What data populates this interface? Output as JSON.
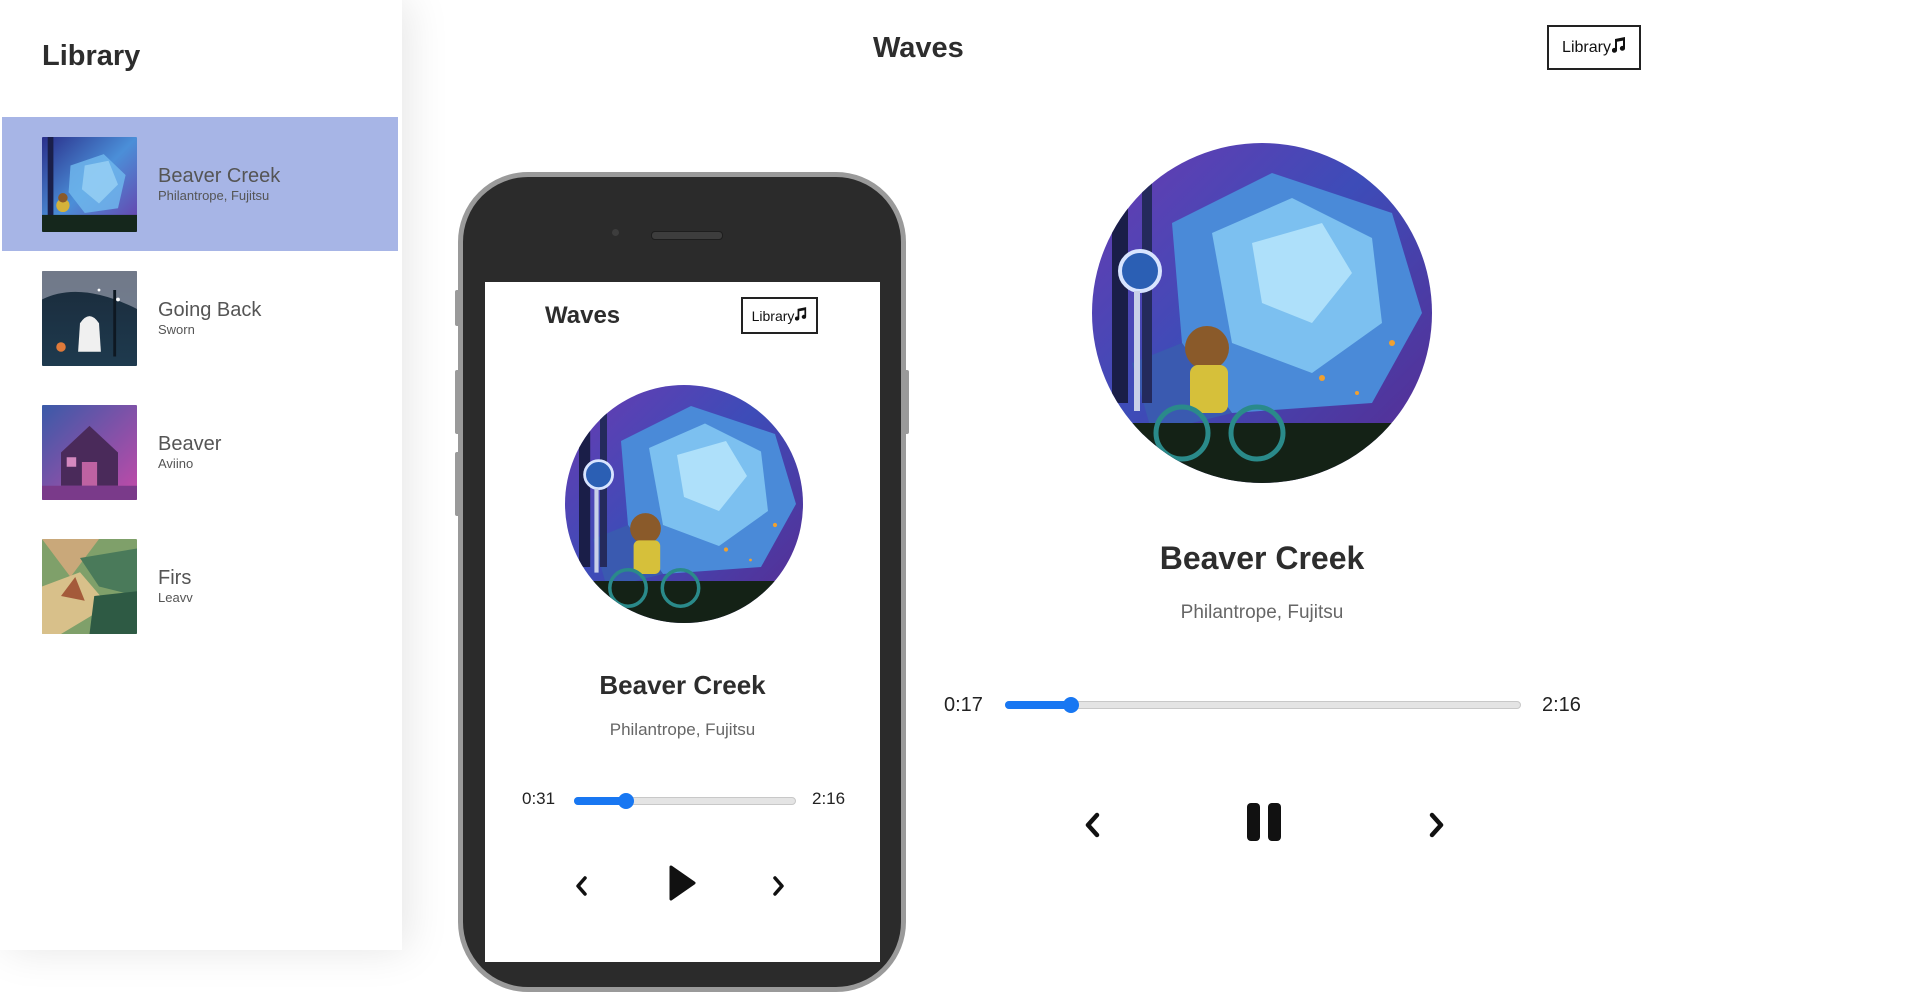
{
  "sidebar": {
    "heading": "Library",
    "items": [
      {
        "title": "Beaver Creek",
        "artist": "Philantrope, Fujitsu",
        "selected": true
      },
      {
        "title": "Going Back",
        "artist": "Sworn",
        "selected": false
      },
      {
        "title": "Beaver",
        "artist": "Aviino",
        "selected": false
      },
      {
        "title": "Firs",
        "artist": "Leavv",
        "selected": false
      }
    ]
  },
  "header": {
    "title": "Waves",
    "library_button": "Library",
    "library_icon": "music-note-icon"
  },
  "phone_preview": {
    "title": "Waves",
    "library_button": "Library",
    "song_title": "Beaver Creek",
    "song_artist": "Philantrope, Fujitsu",
    "current_time": "0:31",
    "total_time": "2:16",
    "progress": 0.23,
    "play_state_icon": "play-icon"
  },
  "player": {
    "song_title": "Beaver Creek",
    "song_artist": "Philantrope, Fujitsu",
    "current_time": "0:17",
    "total_time": "2:16",
    "progress": 0.125,
    "play_state_icon": "pause-icon"
  },
  "colors": {
    "accent": "#1877f2",
    "selected_row": "#a7b5e6",
    "text_dark": "#2d2d2d"
  }
}
